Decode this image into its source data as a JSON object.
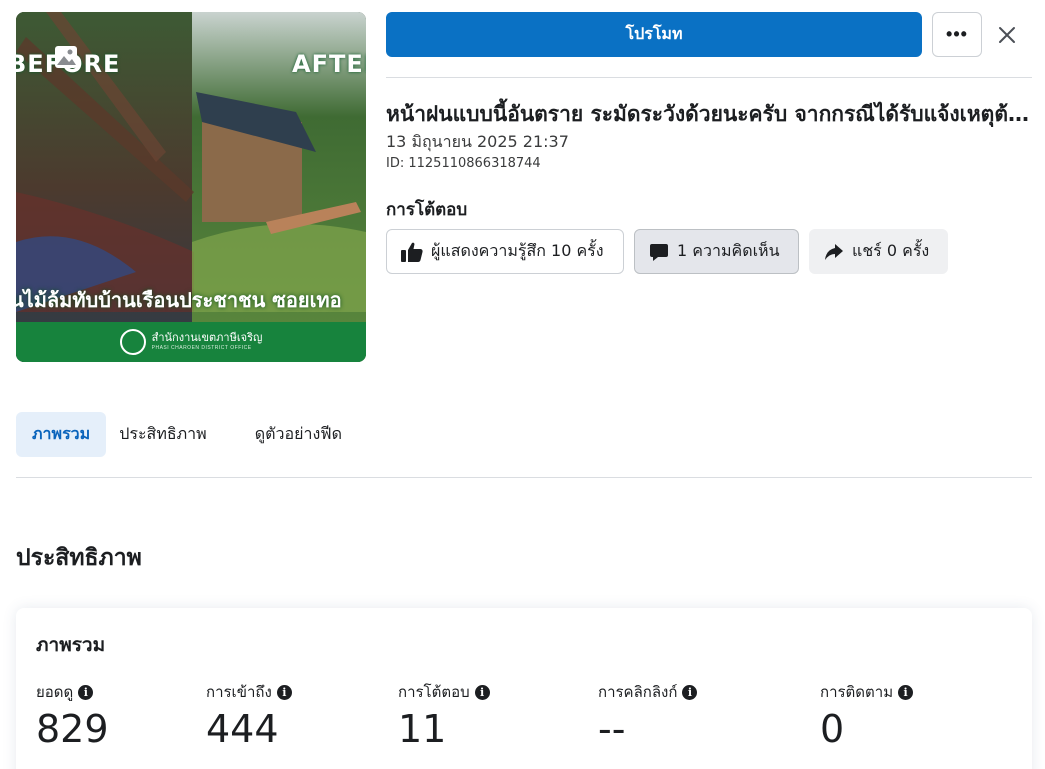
{
  "thumbnail": {
    "before_tag": "BEFORE",
    "after_tag": "AFTER",
    "caption": "นไม้ล้มทับบ้านเรือนประชาชน ซอยเทอ",
    "office_name": "สำนักงานเขตภาษีเจริญ",
    "office_en": "PHASI CHAROEN DISTRICT OFFICE",
    "photo_icon": "photo-icon"
  },
  "actions": {
    "promote_label": "โปรโมท",
    "more_label": "•••",
    "close_icon": "close-icon"
  },
  "post": {
    "title": "หน้าฝนแบบนี้อันตราย ระมัดระวังด้วยนะครับ จากกรณีได้รับแจ้งเหตุต้นไม้ล้มทับบ้านเรือนประชาชน",
    "date": "13 มิถุนายน 2025 21:37",
    "id": "ID: 1125110866318744"
  },
  "reactions": {
    "heading": "การโต้ตอบ",
    "likes": "ผู้แสดงความรู้สึก 10 ครั้ง",
    "comments": "1 ความคิดเห็น",
    "shares": "แชร์ 0 ครั้ง"
  },
  "tabs": [
    {
      "label": "ภาพรวม",
      "active": true
    },
    {
      "label": "ประสิทธิภาพ",
      "active": false
    },
    {
      "label": "ดูตัวอย่างฟีด",
      "active": false
    }
  ],
  "performance": {
    "heading": "ประสิทธิภาพ",
    "card_title": "ภาพรวม",
    "metrics": [
      {
        "label": "ยอดดู",
        "value": "829"
      },
      {
        "label": "การเข้าถึง",
        "value": "444"
      },
      {
        "label": "การโต้ตอบ",
        "value": "11"
      },
      {
        "label": "การคลิกลิงก์",
        "value": "--"
      },
      {
        "label": "การติดตาม",
        "value": "0"
      }
    ]
  },
  "colors": {
    "primary": "#0a71c4",
    "tab_active_bg": "#e5effa",
    "tab_active_text": "#0a64bc",
    "band_green": "#17833d"
  }
}
